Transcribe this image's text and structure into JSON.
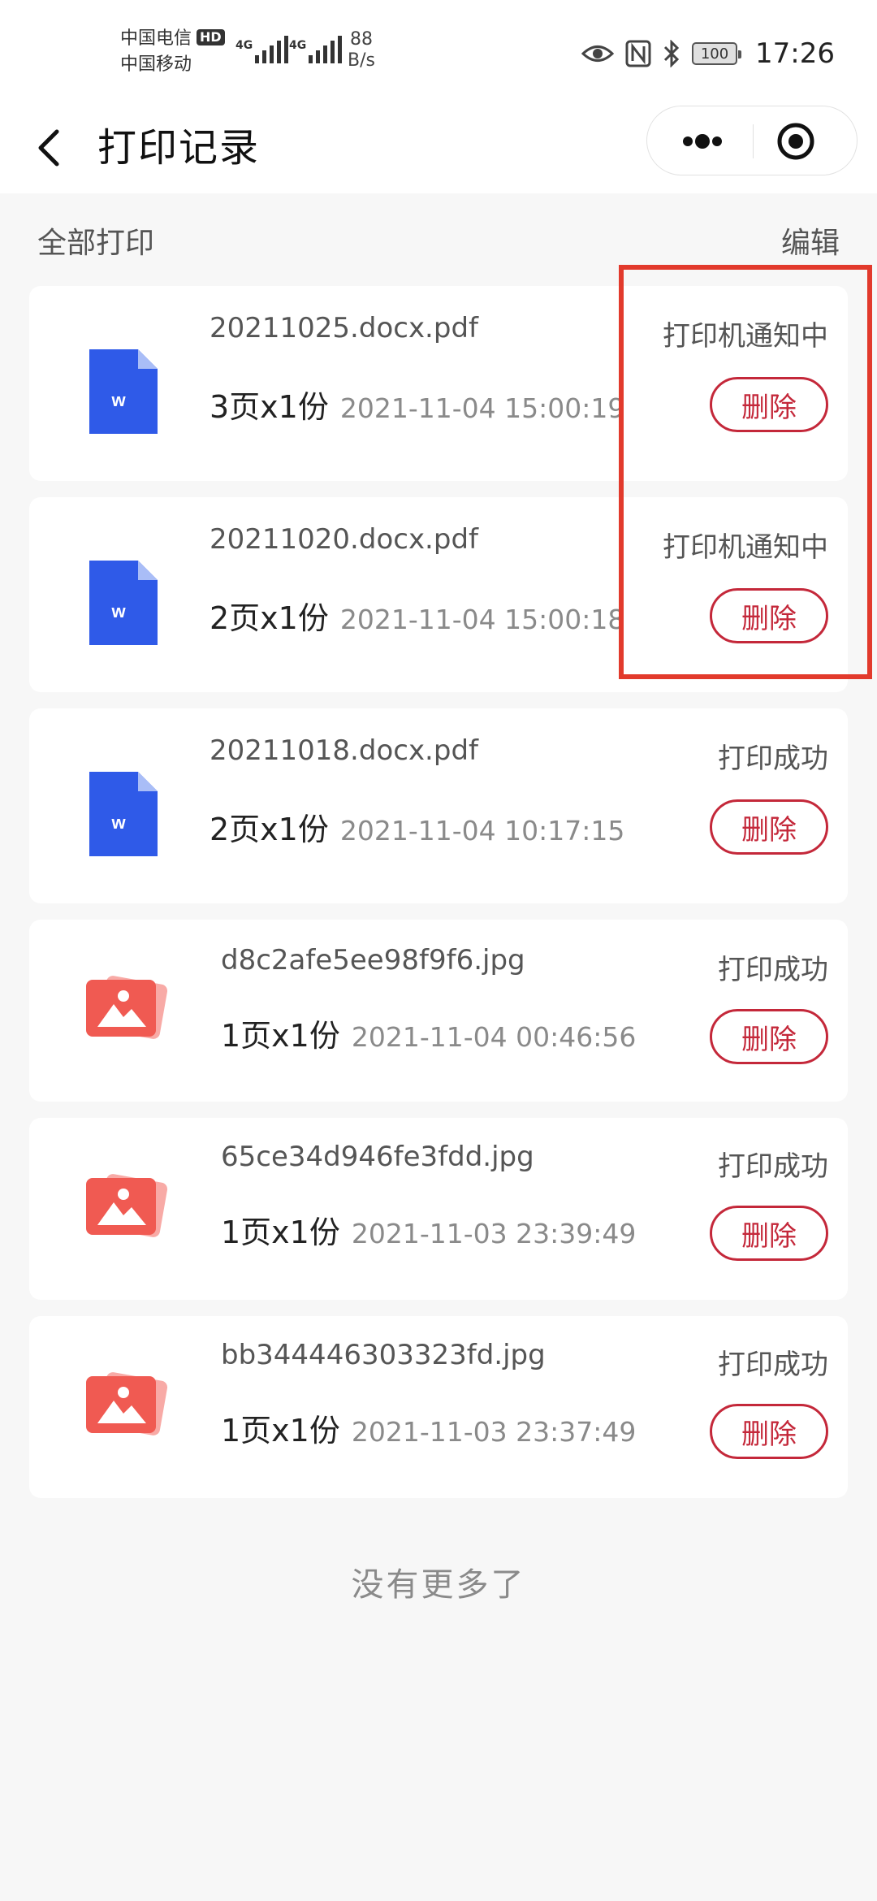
{
  "status_bar": {
    "carrier1": "中国电信",
    "hd_badge": "HD",
    "carrier2": "中国移动",
    "signal1_label": "4G",
    "signal2_label": "4G",
    "speed_value": "88",
    "speed_unit": "B/s",
    "battery": "100",
    "time": "17:26"
  },
  "header": {
    "title": "打印记录"
  },
  "section": {
    "title": "全部打印",
    "edit_label": "编辑"
  },
  "records": [
    {
      "filename": "20211025.docx.pdf",
      "pages": "3页x1份",
      "date": "2021-11-04 15:00:19",
      "status": "打印机通知中",
      "delete_label": "删除",
      "icon": "word-doc-icon"
    },
    {
      "filename": "20211020.docx.pdf",
      "pages": "2页x1份",
      "date": "2021-11-04 15:00:18",
      "status": "打印机通知中",
      "delete_label": "删除",
      "icon": "word-doc-icon"
    },
    {
      "filename": "20211018.docx.pdf",
      "pages": "2页x1份",
      "date": "2021-11-04 10:17:15",
      "status": "打印成功",
      "delete_label": "删除",
      "icon": "word-doc-icon"
    },
    {
      "filename": "d8c2afe5ee98f9f6.jpg",
      "pages": "1页x1份",
      "date": "2021-11-04 00:46:56",
      "status": "打印成功",
      "delete_label": "删除",
      "icon": "image-file-icon"
    },
    {
      "filename": "65ce34d946fe3fdd.jpg",
      "pages": "1页x1份",
      "date": "2021-11-03 23:39:49",
      "status": "打印成功",
      "delete_label": "删除",
      "icon": "image-file-icon"
    },
    {
      "filename": "bb344446303323fd.jpg",
      "pages": "1页x1份",
      "date": "2021-11-03 23:37:49",
      "status": "打印成功",
      "delete_label": "删除",
      "icon": "image-file-icon"
    }
  ],
  "footer": {
    "no_more": "没有更多了"
  },
  "colors": {
    "accent": "#c4283a",
    "word_icon": "#2f5ae8",
    "image_icon": "#f05a52",
    "highlight": "#e23a2c"
  }
}
